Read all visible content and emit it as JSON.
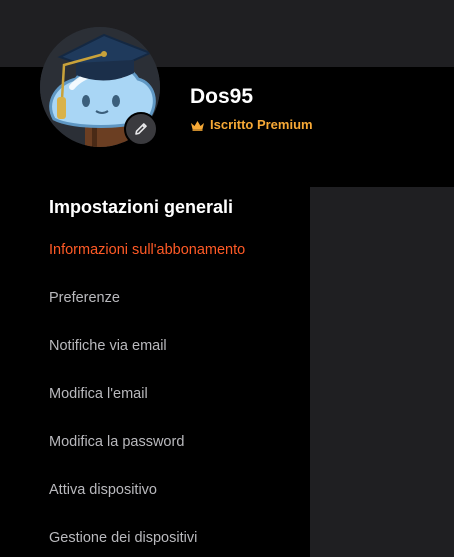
{
  "profile": {
    "username": "Dos95",
    "membership_label": "Iscritto Premium"
  },
  "colors": {
    "background": "#000000",
    "surface": "#1f1f22",
    "accent_active": "#ff5a26",
    "premium": "#f7a936",
    "menu_text": "#b9b9bd"
  },
  "icons": {
    "edit": "pencil-icon",
    "premium": "crown-icon"
  },
  "settings": {
    "heading": "Impostazioni generali",
    "items": [
      {
        "label": "Informazioni sull'abbonamento",
        "active": true
      },
      {
        "label": "Preferenze",
        "active": false
      },
      {
        "label": "Notifiche via email",
        "active": false
      },
      {
        "label": "Modifica l'email",
        "active": false
      },
      {
        "label": "Modifica la password",
        "active": false
      },
      {
        "label": "Attiva dispositivo",
        "active": false
      },
      {
        "label": "Gestione dei dispositivi",
        "active": false
      }
    ]
  }
}
